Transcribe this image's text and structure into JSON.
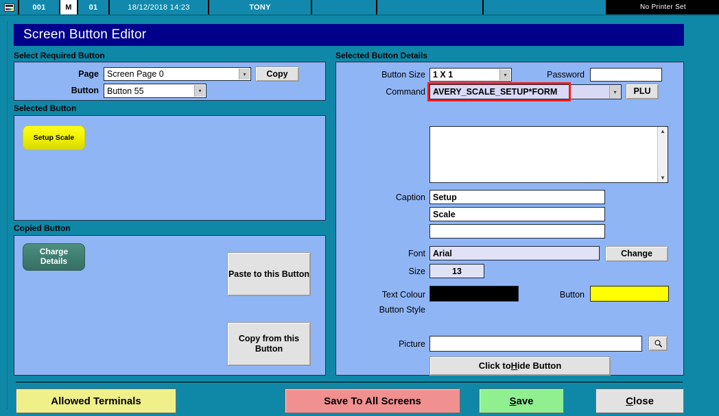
{
  "statusbar": {
    "icon": "app-icon",
    "terminal": "001",
    "mode": "M",
    "till": "01",
    "datetime": "18/12/2018 14:23",
    "operator": "TONY",
    "blank1": "",
    "blank2": "",
    "blank3": "",
    "printer": "No Printer Set"
  },
  "window": {
    "title": "Screen Button Editor"
  },
  "left": {
    "select_group_label": "Select Required Button",
    "page_label": "Page",
    "page_value": "Screen Page 0",
    "copy_label": "Copy",
    "button_label": "Button",
    "button_value": "Button 55",
    "selected_group_label": "Selected Button",
    "selected_preview_caption": "Setup Scale",
    "selected_preview_color": "#f2f200",
    "copied_group_label": "Copied Button",
    "copied_preview_caption_line1": "Charge",
    "copied_preview_caption_line2": "Details",
    "copied_preview_color": "#3f7f72",
    "paste_label": "Paste to this Button",
    "copy_from_label": "Copy from this Button"
  },
  "right": {
    "group_label": "Selected Button Details",
    "button_size_label": "Button Size",
    "button_size_value": "1 X 1",
    "password_label": "Password",
    "password_value": "",
    "command_label": "Command",
    "command_value": "AVERY_SCALE_SETUP*FORM",
    "command_highlight_color": "#ee1c1c",
    "plu_label": "PLU",
    "command_detail_value": "",
    "caption_label": "Caption",
    "caption_line1": "Setup",
    "caption_line2": "Scale",
    "caption_line3": "",
    "font_label": "Font",
    "font_value": "Arial",
    "change_label": "Change",
    "size_label": "Size",
    "size_value": "13",
    "text_colour_label": "Text Colour",
    "text_colour_value": "#000000",
    "button_colour_label": "Button",
    "button_colour_value": "#ffff00",
    "button_style_label": "Button Style",
    "picture_label": "Picture",
    "picture_value": "",
    "browse_icon": "magnifier-icon",
    "hide_button_label_pre": "Click to ",
    "hide_button_label_key": "H",
    "hide_button_label_post": "ide Button"
  },
  "footer": {
    "allowed_terminals_label": "Allowed Terminals",
    "allowed_terminals_color": "#f0f08a",
    "save_all_label": "Save To All Screens",
    "save_all_color": "#f09090",
    "save_label_pre": "",
    "save_label_key": "S",
    "save_label_post": "ave",
    "save_color": "#90f090",
    "close_label_pre": "",
    "close_label_key": "C",
    "close_label_post": "lose",
    "close_color": "#e2e2e2"
  }
}
